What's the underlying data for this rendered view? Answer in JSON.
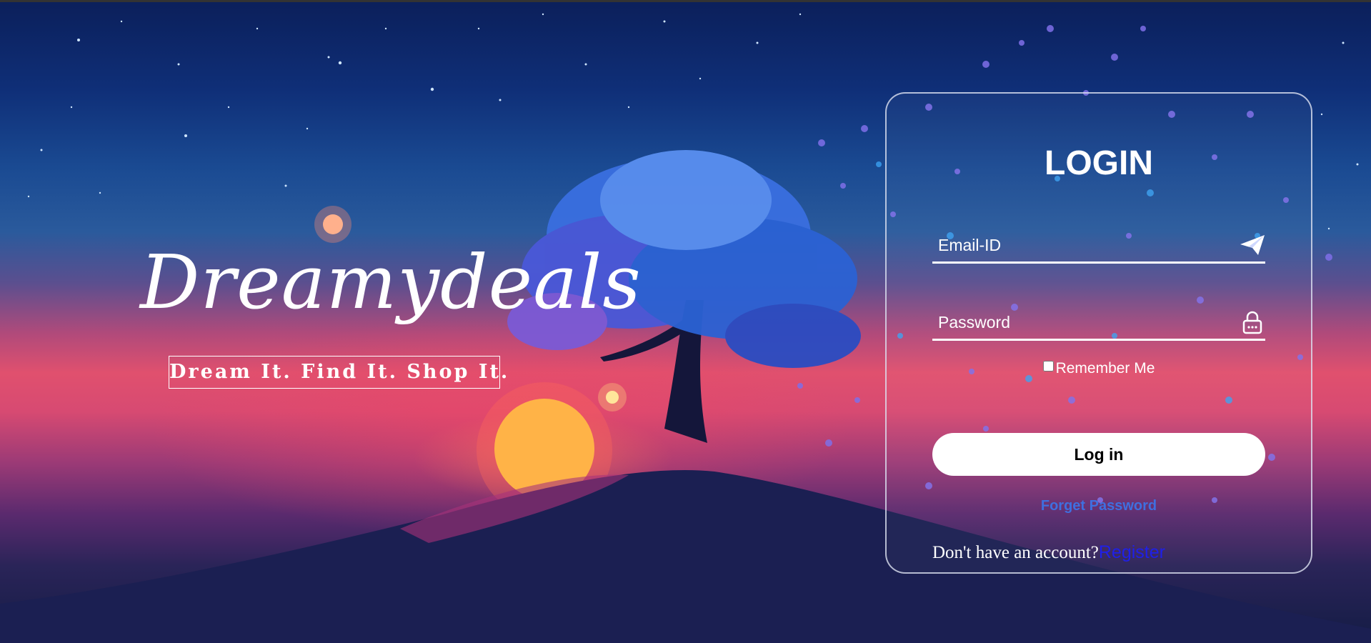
{
  "brand": {
    "title": "Dreamydeals",
    "tagline": "Dream It. Find It. Shop It."
  },
  "login": {
    "heading": "LOGIN",
    "email_placeholder": "Email-ID",
    "email_icon": "paper-plane-icon",
    "password_placeholder": "Password",
    "password_icon": "lock-icon",
    "remember_label": "Remember Me",
    "remember_checked": false,
    "submit_label": "Log in",
    "forgot_label": "Forget Password",
    "register_prompt": "Don't have an account?",
    "register_label": "Register"
  },
  "colors": {
    "accent_link": "#3f6fe0",
    "register_link": "#1f1fe8",
    "button_bg": "#ffffff"
  }
}
